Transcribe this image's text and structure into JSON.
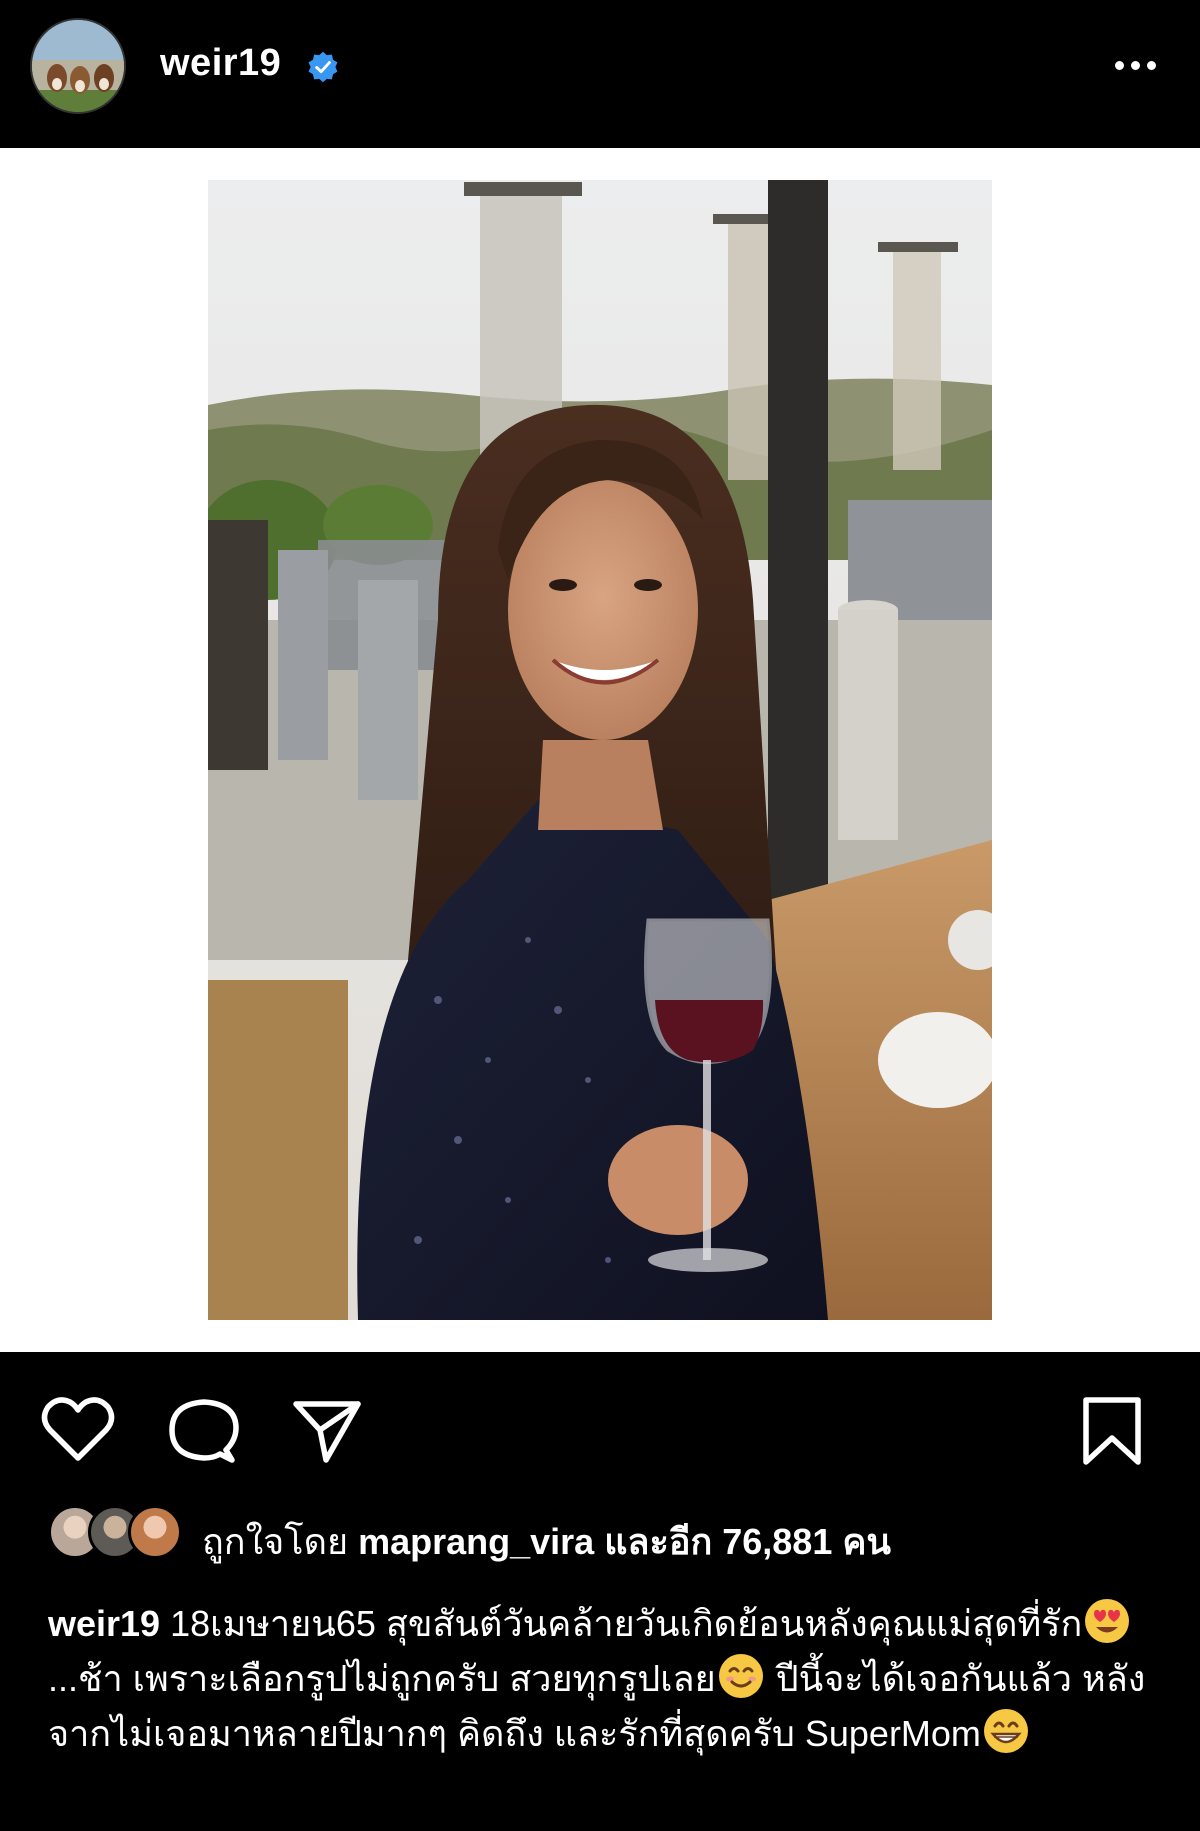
{
  "header": {
    "username": "weir19",
    "verified_icon": "verified-badge-icon",
    "more_icon": "more-options-icon"
  },
  "actions": {
    "like_icon": "heart-icon",
    "comment_icon": "comment-icon",
    "share_icon": "send-icon",
    "save_icon": "bookmark-icon"
  },
  "likes": {
    "prefix": "ถูกใจโดย",
    "user": "maprang_vira",
    "suffix": "และอีก 76,881 คน"
  },
  "caption": {
    "username": "weir19",
    "part1": "18เมษายน65 สุขสันต์วันคล้ายวันเกิดย้อนหลังคุณแม่สุดที่รัก",
    "part2": " ...ช้า เพราะเลือกรูปไม่ถูกครับ สวยทุกรูปเลย",
    "part3": " ปีนี้จะได้เจอกันแล้ว หลังจากไม่เจอมาหลายปีมากๆ คิดถึง และรักที่สุดครับ SuperMom",
    "emoji1": "heart-eyes-emoji",
    "emoji2": "smiling-emoji",
    "emoji3": "grinning-emoji"
  },
  "colors": {
    "background": "#000000",
    "verified": "#3897f0",
    "emoji_yellow": "#f7c843"
  }
}
